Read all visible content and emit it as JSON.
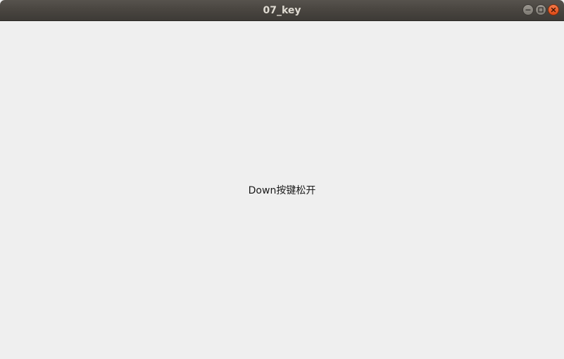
{
  "window": {
    "title": "07_key",
    "controls": {
      "minimize_icon": "minimize-icon",
      "maximize_icon": "maximize-icon",
      "close_icon": "close-icon"
    }
  },
  "content": {
    "status_text": "Down按键松开"
  },
  "colors": {
    "titlebar": "#4a4641",
    "title_text": "#dfdbd2",
    "background": "#efefef",
    "close_button": "#df4a16"
  }
}
